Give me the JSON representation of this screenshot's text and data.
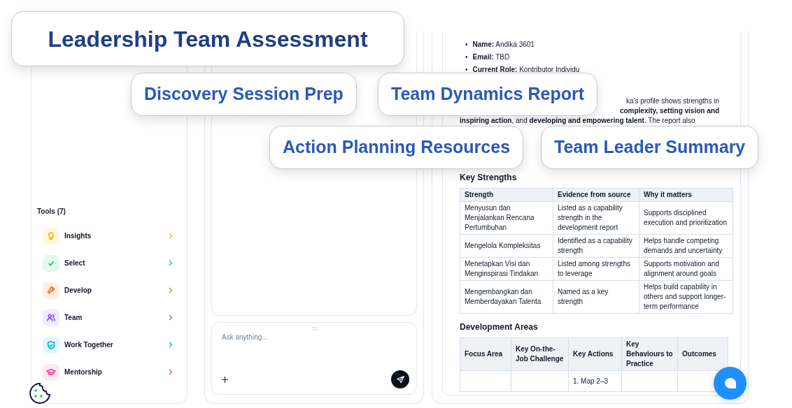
{
  "headline": "Leadership Team Assessment",
  "feature_tags": [
    "Discovery Session Prep",
    "Team Dynamics Report",
    "Action Planning Resources",
    "Team Leader Summary"
  ],
  "sidebar": {
    "section_title": "Tools (7)",
    "tools": [
      {
        "label": "Insights",
        "color": "#f5b400"
      },
      {
        "label": "Select",
        "color": "#22c55e"
      },
      {
        "label": "Develop",
        "color": "#f97316"
      },
      {
        "label": "Team",
        "color": "#8b5cf6"
      },
      {
        "label": "Work Together",
        "color": "#06b6d4"
      },
      {
        "label": "Mentorship",
        "color": "#ec4899"
      }
    ]
  },
  "chat": {
    "placeholder": "Ask anything..."
  },
  "document": {
    "profile": [
      {
        "bullet": "•",
        "label": "Name:",
        "value": "Andika 3601"
      },
      {
        "bullet": "•",
        "label": "Email:",
        "value": "TBD"
      },
      {
        "bullet": "•",
        "label": "Current Role:",
        "value": "Kontributor Individu"
      }
    ],
    "summary_lines": [
      "ka's profile shows strengths in",
      "**complexity, setting vision and**",
      "**inspiring action**, and **developing and empowering talent**. The report also"
    ],
    "strengths": {
      "heading": "Key Strengths",
      "columns": [
        "Strength",
        "Evidence from source",
        "Why it matters"
      ],
      "rows": [
        [
          "Menyusun dan Menjalankan Rencana Pertumbuhan",
          "Listed as a capability strength in the development report",
          "Supports disciplined execution and prioritization"
        ],
        [
          "Mengelola Kompleksitas",
          "Identified as a capability strength",
          "Helps handle competing demands and uncertainty"
        ],
        [
          "Menetapkan Visi dan Menginspirasi Tindakan",
          "Listed among strengths to leverage",
          "Supports motivation and alignment around goals"
        ],
        [
          "Mengembangkan dan Memberdayakan Talenta",
          "Named as a key strength",
          "Helps build capability in others and support longer-term performance"
        ]
      ]
    },
    "development": {
      "heading": "Development Areas",
      "columns": [
        "Focus Area",
        "Key On-the-Job Challenge",
        "Key Actions",
        "Key Behaviours to Practice",
        "Outcomes"
      ],
      "rows": [
        [
          null,
          null,
          "1. Map 2–3",
          null,
          null
        ]
      ]
    }
  }
}
